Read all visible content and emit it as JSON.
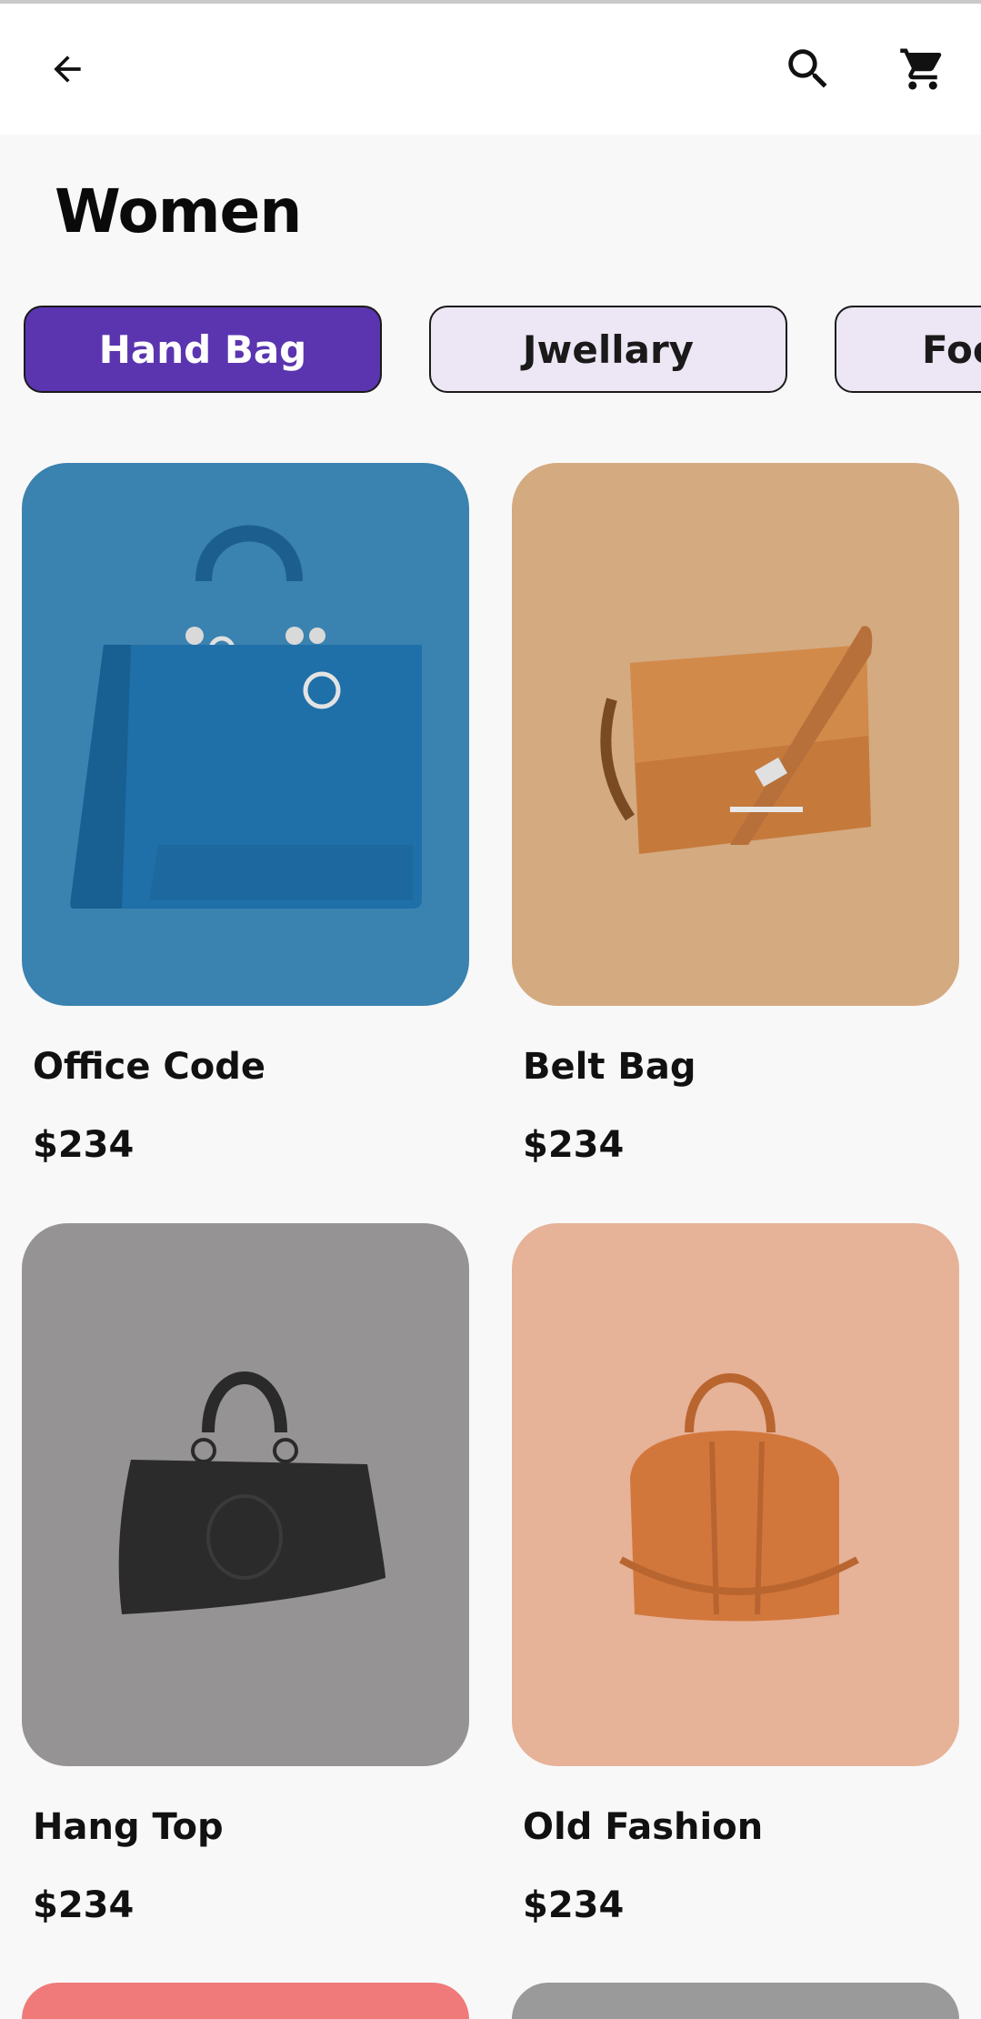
{
  "header": {
    "back_icon": "arrow-back-icon",
    "search_icon": "search-icon",
    "cart_icon": "cart-icon"
  },
  "page_title": "Women",
  "categories": [
    {
      "label": "Hand Bag",
      "selected": true
    },
    {
      "label": "Jwellary",
      "selected": false
    },
    {
      "label": "Foo",
      "selected": false
    }
  ],
  "products": [
    {
      "name": "Office Code",
      "price": "$234",
      "bg_color": "#3a82b0",
      "bag_color": "#1f6fa8",
      "image_icon": "blue-tote-handbag-icon"
    },
    {
      "name": "Belt Bag",
      "price": "$234",
      "bg_color": "#d4aa80",
      "bag_color": "#c57a3c",
      "image_icon": "tan-messenger-bag-icon"
    },
    {
      "name": "Hang Top",
      "price": "$234",
      "bg_color": "#959393",
      "bag_color": "#2b2b2b",
      "image_icon": "black-leather-handbag-icon"
    },
    {
      "name": "Old Fashion",
      "price": "$234",
      "bg_color": "#e6b298",
      "bag_color": "#d2773b",
      "image_icon": "orange-duffel-bag-icon"
    }
  ],
  "colors": {
    "accent": "#5b35b0",
    "chip_bg": "#ede6f4",
    "background": "#f8f8f8",
    "peek_left": "#f07a7a",
    "peek_right": "#9a9a9a"
  }
}
